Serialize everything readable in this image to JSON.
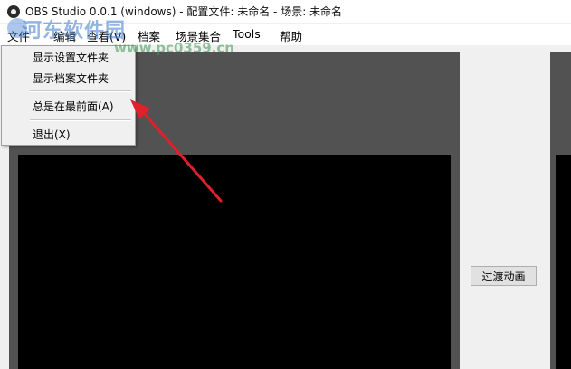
{
  "window": {
    "title": "OBS Studio 0.0.1 (windows) - 配置文件: 未命名 - 场景: 未命名"
  },
  "menubar": {
    "items": [
      "文件",
      "编辑",
      "查看(V)",
      "档案",
      "场景集合",
      "Tools",
      "帮助"
    ]
  },
  "file_menu": {
    "items": [
      "显示设置文件夹",
      "显示档案文件夹",
      "总是在最前面(A)",
      "退出(X)"
    ]
  },
  "main": {
    "transition_button": "过渡动画"
  },
  "watermark": {
    "site_name": "河东软件园",
    "url": "www.pc0359.cn"
  },
  "colors": {
    "annotation_arrow": "#e0202a",
    "preview_bg": "#525252",
    "canvas": "#000000"
  },
  "icons": {
    "app": "obs-logo-icon",
    "watermark_logo": "river-east-logo-icon"
  }
}
